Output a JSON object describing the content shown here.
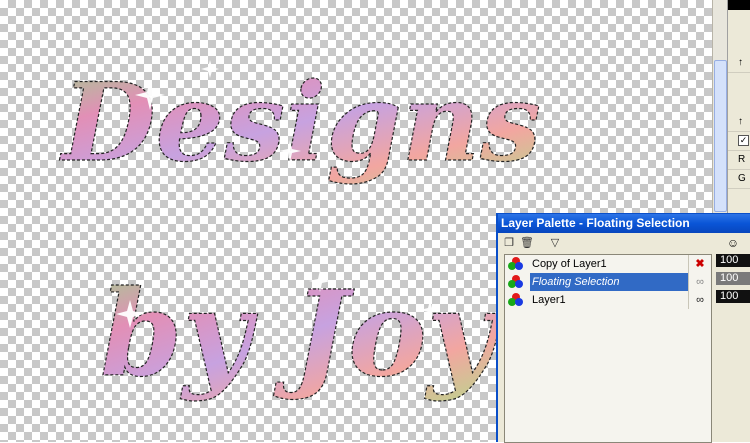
{
  "canvas": {
    "artwork_line1": "Designs",
    "artwork_line2": "by Joy"
  },
  "side_panel": {
    "rows": [
      "↑",
      "↑",
      "R",
      "G"
    ]
  },
  "layer_palette": {
    "title": "Layer Palette - Floating Selection",
    "layers": [
      {
        "name": "Copy of Layer1",
        "visibility": "hidden",
        "opacity": "100"
      },
      {
        "name": "Floating Selection",
        "visibility": "visible",
        "opacity": "100",
        "selected": true
      },
      {
        "name": "Layer1",
        "visibility": "visible",
        "opacity": "100"
      }
    ],
    "icons": {
      "new_layer": "new-layer-icon",
      "delete_layer": "delete-layer-icon",
      "mask": "mask-icon",
      "opacity_header": "opacity-icon"
    }
  },
  "colors": {
    "titlebar": "#0a55d7",
    "selection": "#316ac5",
    "palette_bg": "#ece9d8"
  }
}
